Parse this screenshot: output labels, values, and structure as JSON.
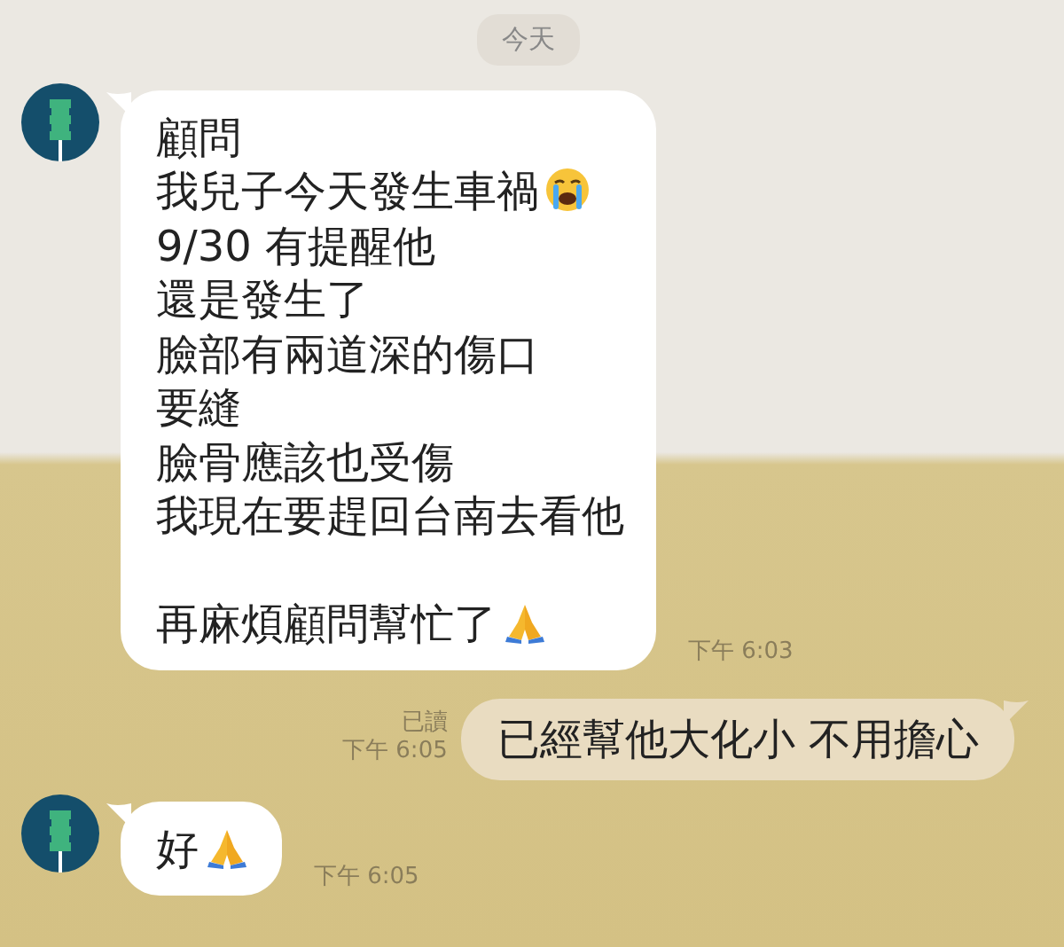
{
  "date_divider": "今天",
  "messages": [
    {
      "kind": "incoming",
      "lines": [
        {
          "text": "顧問"
        },
        {
          "text": "我兒子今天發生車禍",
          "kind": "crying"
        },
        {
          "text": "9/30 有提醒他"
        },
        {
          "text": "還是發生了"
        },
        {
          "text": "臉部有兩道深的傷口"
        },
        {
          "text": "要縫"
        },
        {
          "text": "臉骨應該也受傷"
        },
        {
          "text": "我現在要趕回台南去看他"
        },
        {
          "kind": "blank"
        },
        {
          "text": "再麻煩顧問幫忙了",
          "kind": "praying"
        }
      ],
      "time": "下午 6:03"
    },
    {
      "kind": "outgoing",
      "read": "已讀",
      "lines": [
        {
          "text": "已經幫他大化小 不用擔心"
        }
      ],
      "time": "下午 6:05"
    },
    {
      "kind": "incoming",
      "lines": [
        {
          "text": "好",
          "kind": "praying"
        }
      ],
      "time": "下午 6:05"
    }
  ]
}
